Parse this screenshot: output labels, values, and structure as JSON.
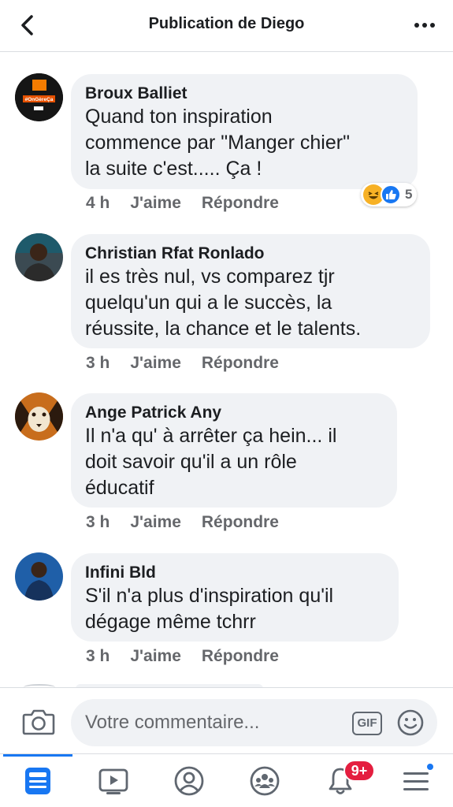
{
  "header": {
    "title": "Publication de Diego"
  },
  "comments": [
    {
      "author": "Broux Balliet",
      "text": "Quand ton inspiration\ncommence par \"Manger chier\"\nla suite c'est..... Ça !",
      "time": "4 h",
      "like": "J'aime",
      "reply": "Répondre",
      "reaction_count": "5",
      "avatar_text": "#OnGèreÇa"
    },
    {
      "author": "Christian Rfat Ronlado",
      "text": "il es très nul, vs comparez tjr\nquelqu'un qui a le succès, la\nréussite, la chance et le talents.",
      "time": "3 h",
      "like": "J'aime",
      "reply": "Répondre"
    },
    {
      "author": "Ange Patrick Any",
      "text": "Il n'a qu' à arrêter ça hein... il\ndoit savoir qu'il a un rôle\néducatif",
      "time": "3 h",
      "like": "J'aime",
      "reply": "Répondre"
    },
    {
      "author": "Infini Bld",
      "text": "S'il n'a plus d'inspiration qu'il\ndégage même tchrr",
      "time": "3 h",
      "like": "J'aime",
      "reply": "Répondre"
    }
  ],
  "composer": {
    "placeholder": "Votre commentaire...",
    "gif_label": "GIF"
  },
  "nav": {
    "notifications_badge": "9+"
  },
  "icons": [
    "back-arrow-icon",
    "more-icon",
    "camera-icon",
    "gif-icon",
    "emoji-icon",
    "news-feed-icon",
    "watch-icon",
    "profile-icon",
    "groups-icon",
    "bell-icon",
    "menu-icon"
  ],
  "colors": {
    "accent": "#1877f2",
    "bubble": "#f0f2f5",
    "badge": "#e41e3f",
    "secondary_text": "#65676b"
  }
}
